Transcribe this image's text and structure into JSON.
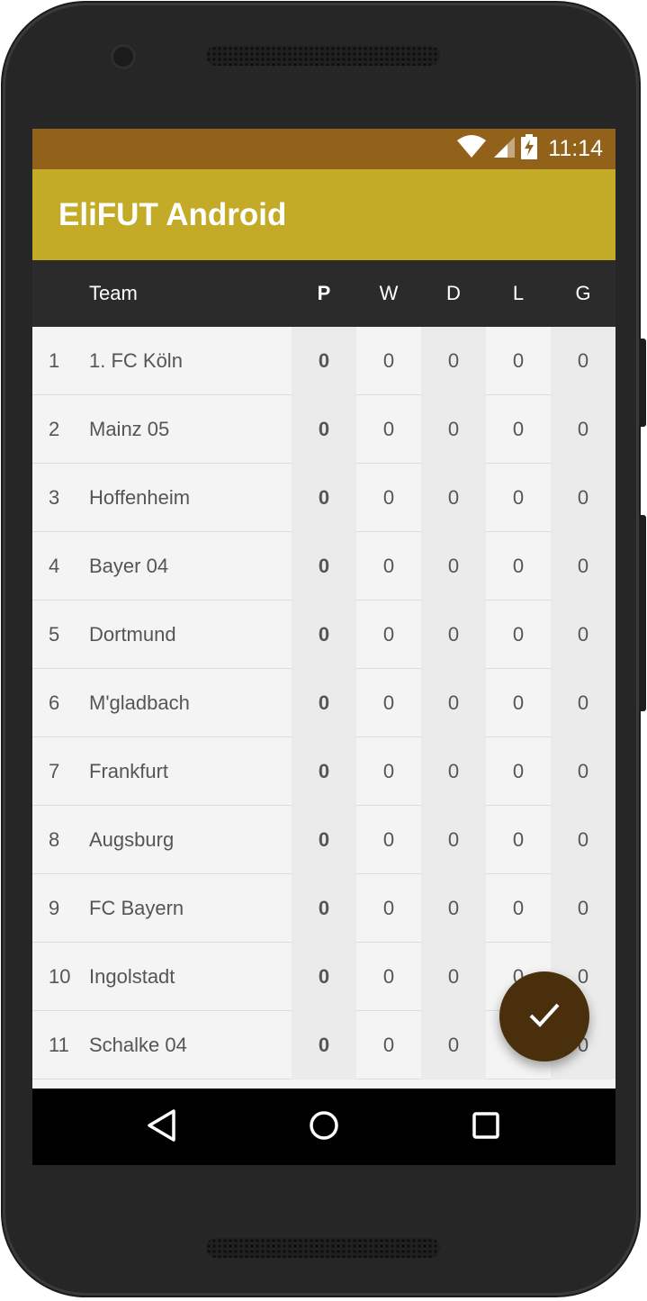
{
  "status": {
    "time": "11:14"
  },
  "app": {
    "title": "EliFUT Android"
  },
  "table": {
    "headers": {
      "team": "Team",
      "p": "P",
      "w": "W",
      "d": "D",
      "l": "L",
      "g": "G"
    },
    "rows": [
      {
        "pos": "1",
        "team": "1. FC Köln",
        "p": "0",
        "w": "0",
        "d": "0",
        "l": "0",
        "g": "0"
      },
      {
        "pos": "2",
        "team": "Mainz 05",
        "p": "0",
        "w": "0",
        "d": "0",
        "l": "0",
        "g": "0"
      },
      {
        "pos": "3",
        "team": "Hoffenheim",
        "p": "0",
        "w": "0",
        "d": "0",
        "l": "0",
        "g": "0"
      },
      {
        "pos": "4",
        "team": "Bayer 04",
        "p": "0",
        "w": "0",
        "d": "0",
        "l": "0",
        "g": "0"
      },
      {
        "pos": "5",
        "team": "Dortmund",
        "p": "0",
        "w": "0",
        "d": "0",
        "l": "0",
        "g": "0"
      },
      {
        "pos": "6",
        "team": "M'gladbach",
        "p": "0",
        "w": "0",
        "d": "0",
        "l": "0",
        "g": "0"
      },
      {
        "pos": "7",
        "team": "Frankfurt",
        "p": "0",
        "w": "0",
        "d": "0",
        "l": "0",
        "g": "0"
      },
      {
        "pos": "8",
        "team": "Augsburg",
        "p": "0",
        "w": "0",
        "d": "0",
        "l": "0",
        "g": "0"
      },
      {
        "pos": "9",
        "team": "FC Bayern",
        "p": "0",
        "w": "0",
        "d": "0",
        "l": "0",
        "g": "0"
      },
      {
        "pos": "10",
        "team": "Ingolstadt",
        "p": "0",
        "w": "0",
        "d": "0",
        "l": "0",
        "g": "0"
      },
      {
        "pos": "11",
        "team": "Schalke 04",
        "p": "0",
        "w": "0",
        "d": "0",
        "l": "0",
        "g": "0"
      }
    ]
  },
  "colors": {
    "status_bar": "#92621a",
    "app_bar": "#c4ab27",
    "table_header": "#2b2b2b",
    "fab": "#4a2f0c"
  },
  "icons": {
    "status": [
      "wifi-icon",
      "signal-icon",
      "battery-charging-icon"
    ],
    "nav": [
      "back-icon",
      "home-icon",
      "recents-icon"
    ],
    "fab": "check-icon"
  }
}
